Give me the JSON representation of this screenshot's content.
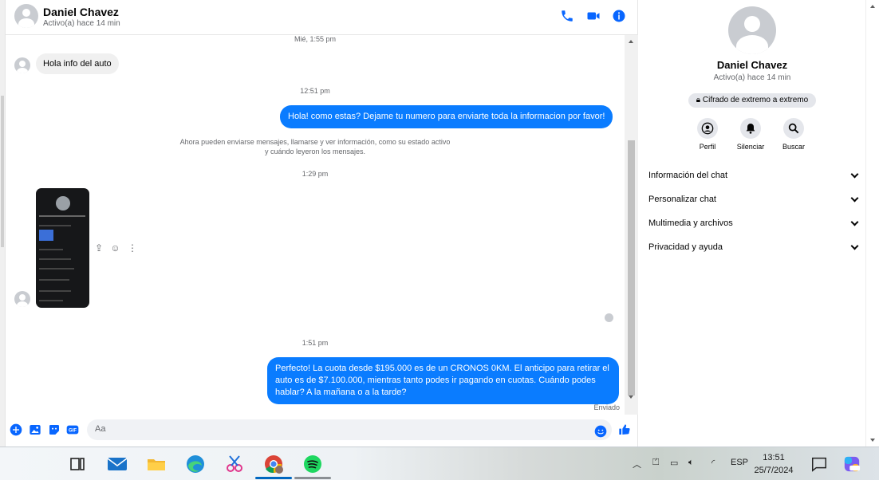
{
  "header": {
    "name": "Daniel Chavez",
    "status": "Activo(a) hace 14 min"
  },
  "messages": {
    "ts1": "Mié, 1:55 pm",
    "msg_in_1": "Hola info del auto",
    "ts2": "12:51 pm",
    "msg_out_1": "Hola! como estas? Dejame tu numero para enviarte toda la informacion por favor!",
    "notice": "Ahora pueden enviarse mensajes, llamarse y ver información, como su estado activo y cuándo leyeron los mensajes.",
    "ts3": "1:29 pm",
    "ts4": "1:51 pm",
    "msg_out_2": "Perfecto! La cuota desde $195.000 es de un CRONOS 0KM. El anticipo para retirar el auto es de $7.100.000, mientras tanto podes ir pagando en cuotas. Cuándo podes hablar? A la mañana o a la tarde?",
    "delivery_status": "Enviado"
  },
  "composer": {
    "placeholder": "Aa"
  },
  "info": {
    "name": "Daniel Chavez",
    "status": "Activo(a) hace 14 min",
    "encryption": "Cifrado de extremo a extremo",
    "actions": [
      "Perfil",
      "Silenciar",
      "Buscar"
    ],
    "sections": [
      "Información del chat",
      "Personalizar chat",
      "Multimedia y archivos",
      "Privacidad y ayuda"
    ]
  },
  "taskbar": {
    "language": "ESP",
    "time": "13:51",
    "date": "25/7/2024"
  },
  "colors": {
    "accent": "#0a7cff",
    "icon_blue": "#0866ff"
  }
}
